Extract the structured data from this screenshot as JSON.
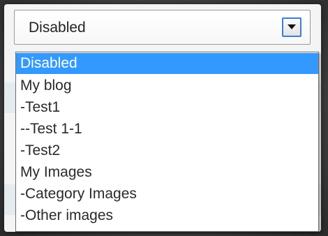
{
  "select": {
    "value": "Disabled",
    "arrow_icon": "chevron-down-icon"
  },
  "options": [
    {
      "label": "Disabled",
      "selected": true
    },
    {
      "label": "My blog",
      "selected": false
    },
    {
      "label": "-Test1",
      "selected": false
    },
    {
      "label": "--Test 1-1",
      "selected": false
    },
    {
      "label": "-Test2",
      "selected": false
    },
    {
      "label": "My Images",
      "selected": false
    },
    {
      "label": "-Category Images",
      "selected": false
    },
    {
      "label": "-Other images",
      "selected": false
    }
  ],
  "colors": {
    "selected_background": "#3399ff",
    "selected_text": "#ffffff",
    "option_text": "#2a2a2a"
  }
}
